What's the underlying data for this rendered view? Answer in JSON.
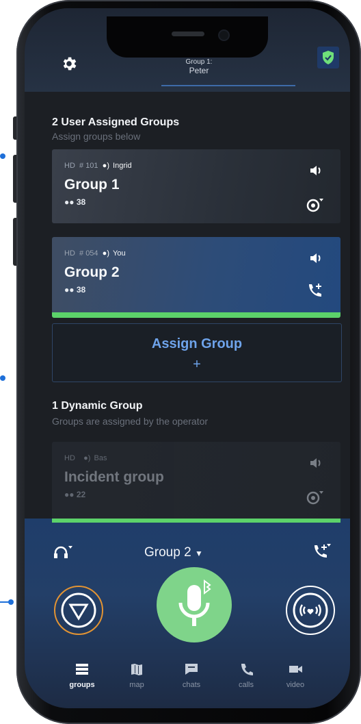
{
  "header": {
    "group_prefix": "Group 1:",
    "group_user": "Peter"
  },
  "assigned": {
    "title": "2  User Assigned Groups",
    "subtitle": "Assign groups below"
  },
  "groups": [
    {
      "quality": "HD",
      "number": "# 101",
      "speaker": "Ingrid",
      "name": "Group 1",
      "members": "38"
    },
    {
      "quality": "HD",
      "number": "# 054",
      "speaker": "You",
      "name": "Group 2",
      "members": "38"
    }
  ],
  "assign_button": {
    "label": "Assign Group",
    "plus": "+"
  },
  "dynamic": {
    "title": "1  Dynamic Group",
    "subtitle": "Groups are assigned by the operator"
  },
  "dynamic_group": {
    "quality": "HD",
    "speaker": "Bas",
    "name": "Incident group",
    "members": "22"
  },
  "bottom": {
    "selected_group": "Group 2"
  },
  "nav": [
    {
      "label": "groups"
    },
    {
      "label": "map"
    },
    {
      "label": "chats"
    },
    {
      "label": "calls"
    },
    {
      "label": "video"
    }
  ],
  "colors": {
    "accent": "#5cd26a",
    "blue": "#6ea3ea",
    "stop": "#e39433"
  }
}
